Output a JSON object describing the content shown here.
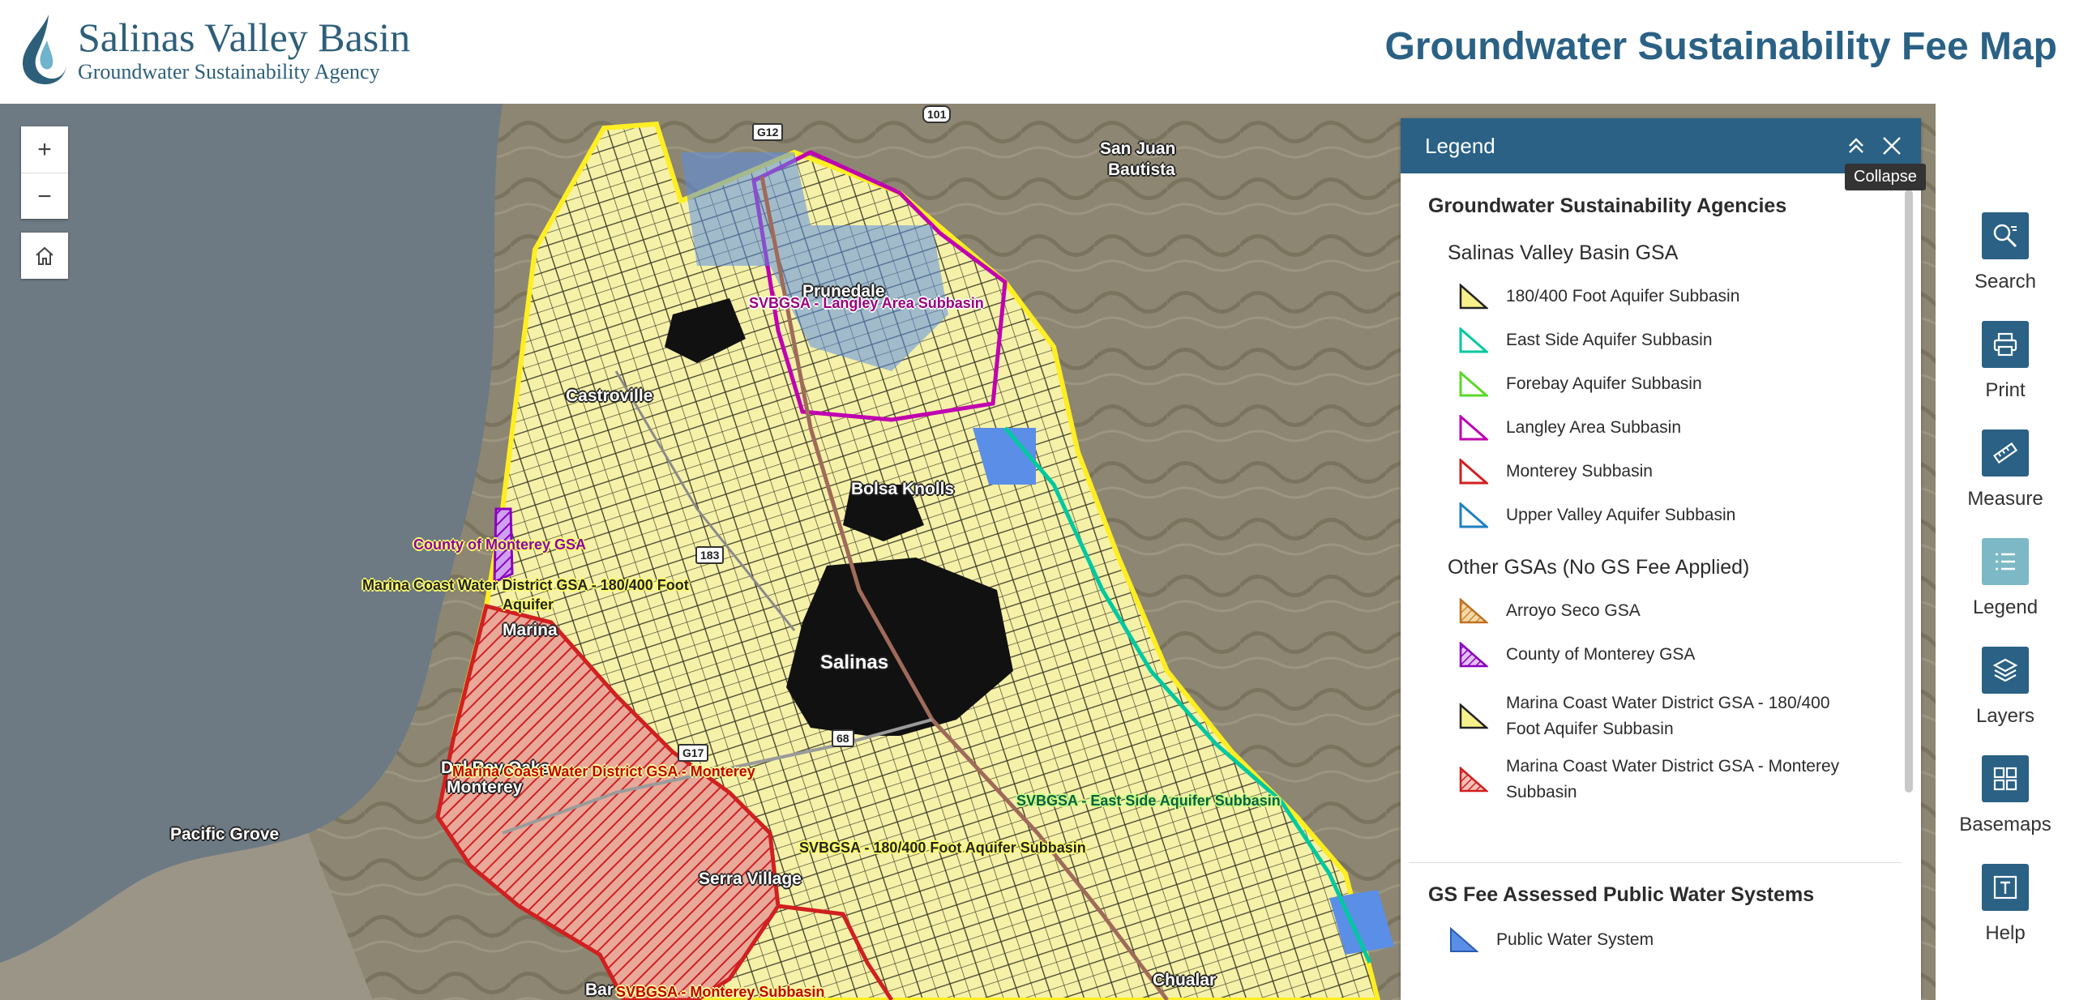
{
  "header": {
    "logo_title": "Salinas Valley Basin",
    "logo_subtitle": "Groundwater Sustainability Agency",
    "app_title": "Groundwater Sustainability Fee Map"
  },
  "colors": {
    "brand": "#2a6185",
    "toolbar_active": "#7db8c6",
    "yellow_subbasin": "#f7f08a",
    "east_side": "#00c8a0",
    "forebay": "#5ad828",
    "langley": "#c000b0",
    "monterey": "#d02020",
    "upper_valley": "#2080c0",
    "public_water": "#5b8ee6"
  },
  "map": {
    "places": [
      "San Juan",
      "Bautista",
      "Prunedale",
      "Castroville",
      "Bolsa Knolls",
      "Salinas",
      "Marina",
      "Pacific Grove",
      "Serra Village",
      "Chualar",
      "Del Rey Oaks",
      "Monterey",
      "Bar"
    ],
    "gsa_labels": {
      "langley": "SVBGSA - Langley Area Subbasin",
      "county": "County of Monterey GSA",
      "mcwd_180_line1": "Marina Coast Water District GSA - 180/400 Foot",
      "mcwd_180_line2": "Aquifer",
      "mcwd_monterey": "Marina Coast Water District GSA - Monterey",
      "east_side": "SVBGSA - East Side Aquifer Subbasin",
      "foot_180": "SVBGSA - 180/400 Foot Aquifer Subbasin",
      "monterey": "SVBGSA - Monterey Subbasin"
    },
    "routes": [
      "G12",
      "101",
      "183",
      "68",
      "G17"
    ],
    "zoom_in": "+",
    "zoom_out": "−"
  },
  "legend": {
    "title": "Legend",
    "collapse_tooltip": "Collapse",
    "sections": [
      {
        "title": "Groundwater Sustainability Agencies",
        "groups": [
          {
            "title": "Salinas Valley Basin GSA",
            "items": [
              {
                "label": "180/400 Foot Aquifer Subbasin",
                "fill": "#f7f08a",
                "stroke": "#222"
              },
              {
                "label": "East Side Aquifer Subbasin",
                "fill": "#ffffff",
                "stroke": "#00c8a0"
              },
              {
                "label": "Forebay Aquifer Subbasin",
                "fill": "#ffffff",
                "stroke": "#5ad828"
              },
              {
                "label": "Langley Area Subbasin",
                "fill": "#ffffff",
                "stroke": "#c000b0"
              },
              {
                "label": "Monterey Subbasin",
                "fill": "#ffffff",
                "stroke": "#d02020"
              },
              {
                "label": "Upper Valley Aquifer Subbasin",
                "fill": "#ffffff",
                "stroke": "#2080c0"
              }
            ]
          },
          {
            "title": "Other GSAs (No GS Fee Applied)",
            "items": [
              {
                "label": "Arroyo Seco GSA",
                "fill": "hatch-orange",
                "stroke": "#c07020"
              },
              {
                "label": "County of Monterey GSA",
                "fill": "hatch-purple",
                "stroke": "#8b00c0"
              },
              {
                "label": "Marina Coast Water District GSA - 180/400 Foot Aquifer Subbasin",
                "fill": "#f7f08a",
                "stroke": "#222"
              },
              {
                "label": "Marina Coast Water District GSA - Monterey Subbasin",
                "fill": "hatch-red",
                "stroke": "#d02020"
              }
            ]
          }
        ]
      },
      {
        "title": "GS Fee Assessed Public Water Systems",
        "items": [
          {
            "label": "Public Water System",
            "fill": "#5b8ee6",
            "stroke": "#2a5bb0"
          }
        ]
      }
    ]
  },
  "toolbar": {
    "search": "Search",
    "print": "Print",
    "measure": "Measure",
    "legend": "Legend",
    "layers": "Layers",
    "basemaps": "Basemaps",
    "help": "Help"
  }
}
